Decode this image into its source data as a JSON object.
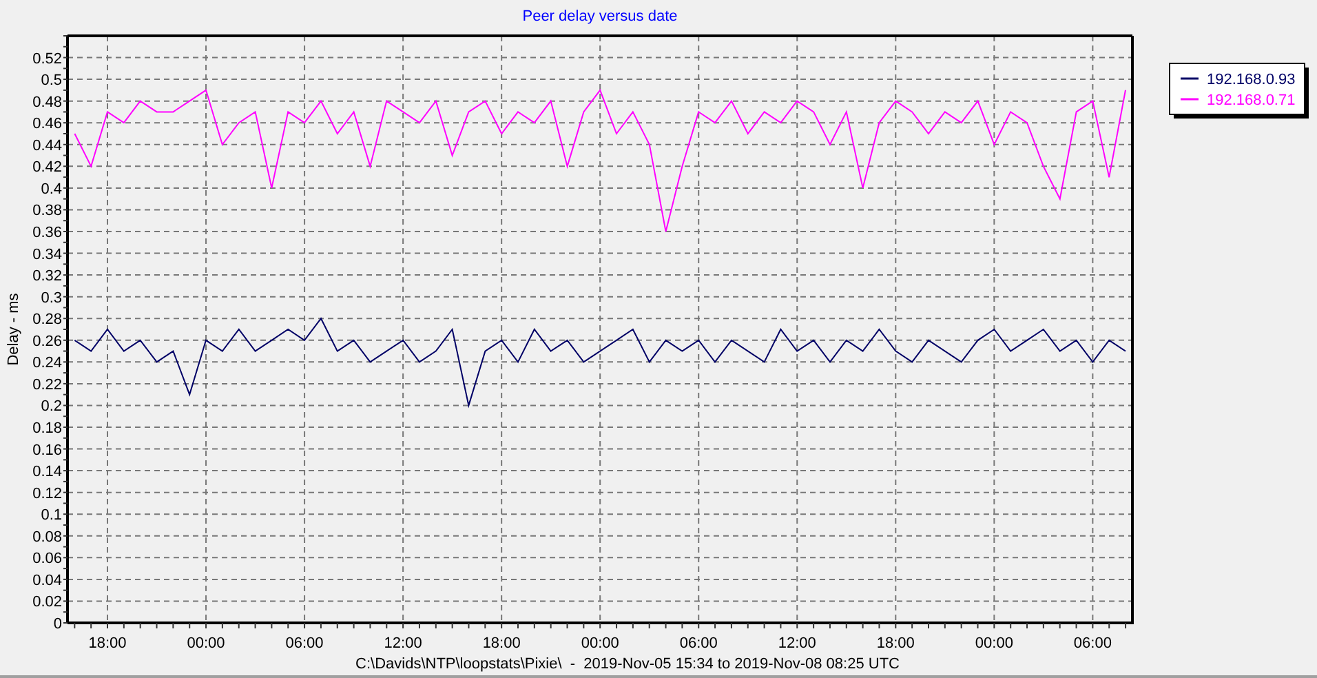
{
  "chart": {
    "chart_data": {
      "type": "line",
      "title": "Peer delay versus date",
      "xlabel": "C:\\Davids\\NTP\\loopstats\\Pixie\\  -  2019-Nov-05 15:34 to 2019-Nov-08 08:25 UTC",
      "ylabel": "Delay - ms",
      "x": [
        "2019-11-05T16:00",
        "2019-11-05T17:00",
        "2019-11-05T18:00",
        "2019-11-05T19:00",
        "2019-11-05T20:00",
        "2019-11-05T21:00",
        "2019-11-05T22:00",
        "2019-11-05T23:00",
        "2019-11-06T00:00",
        "2019-11-06T01:00",
        "2019-11-06T02:00",
        "2019-11-06T03:00",
        "2019-11-06T04:00",
        "2019-11-06T05:00",
        "2019-11-06T06:00",
        "2019-11-06T07:00",
        "2019-11-06T08:00",
        "2019-11-06T09:00",
        "2019-11-06T10:00",
        "2019-11-06T11:00",
        "2019-11-06T12:00",
        "2019-11-06T13:00",
        "2019-11-06T14:00",
        "2019-11-06T15:00",
        "2019-11-06T16:00",
        "2019-11-06T17:00",
        "2019-11-06T18:00",
        "2019-11-06T19:00",
        "2019-11-06T20:00",
        "2019-11-06T21:00",
        "2019-11-06T22:00",
        "2019-11-06T23:00",
        "2019-11-07T00:00",
        "2019-11-07T01:00",
        "2019-11-07T02:00",
        "2019-11-07T03:00",
        "2019-11-07T04:00",
        "2019-11-07T05:00",
        "2019-11-07T06:00",
        "2019-11-07T07:00",
        "2019-11-07T08:00",
        "2019-11-07T09:00",
        "2019-11-07T10:00",
        "2019-11-07T11:00",
        "2019-11-07T12:00",
        "2019-11-07T13:00",
        "2019-11-07T14:00",
        "2019-11-07T15:00",
        "2019-11-07T16:00",
        "2019-11-07T17:00",
        "2019-11-07T18:00",
        "2019-11-07T19:00",
        "2019-11-07T20:00",
        "2019-11-07T21:00",
        "2019-11-07T22:00",
        "2019-11-07T23:00",
        "2019-11-08T00:00",
        "2019-11-08T01:00",
        "2019-11-08T02:00",
        "2019-11-08T03:00",
        "2019-11-08T04:00",
        "2019-11-08T05:00",
        "2019-11-08T06:00",
        "2019-11-08T07:00",
        "2019-11-08T08:00"
      ],
      "series": [
        {
          "name": "192.168.0.93",
          "color": "#000066",
          "values": [
            0.26,
            0.25,
            0.27,
            0.25,
            0.26,
            0.24,
            0.25,
            0.21,
            0.26,
            0.25,
            0.27,
            0.25,
            0.26,
            0.27,
            0.26,
            0.28,
            0.25,
            0.26,
            0.24,
            0.25,
            0.26,
            0.24,
            0.25,
            0.27,
            0.2,
            0.25,
            0.26,
            0.24,
            0.27,
            0.25,
            0.26,
            0.24,
            0.25,
            0.26,
            0.27,
            0.24,
            0.26,
            0.25,
            0.26,
            0.24,
            0.26,
            0.25,
            0.24,
            0.27,
            0.25,
            0.26,
            0.24,
            0.26,
            0.25,
            0.27,
            0.25,
            0.24,
            0.26,
            0.25,
            0.24,
            0.26,
            0.27,
            0.25,
            0.26,
            0.27,
            0.25,
            0.26,
            0.24,
            0.26,
            0.25
          ]
        },
        {
          "name": "192.168.0.71",
          "color": "#ff00ff",
          "values": [
            0.45,
            0.42,
            0.47,
            0.46,
            0.48,
            0.47,
            0.47,
            0.48,
            0.49,
            0.44,
            0.46,
            0.47,
            0.4,
            0.47,
            0.46,
            0.48,
            0.45,
            0.47,
            0.42,
            0.48,
            0.47,
            0.46,
            0.48,
            0.43,
            0.47,
            0.48,
            0.45,
            0.47,
            0.46,
            0.48,
            0.42,
            0.47,
            0.49,
            0.45,
            0.47,
            0.44,
            0.36,
            0.42,
            0.47,
            0.46,
            0.48,
            0.45,
            0.47,
            0.46,
            0.48,
            0.47,
            0.44,
            0.47,
            0.4,
            0.46,
            0.48,
            0.47,
            0.45,
            0.47,
            0.46,
            0.48,
            0.44,
            0.47,
            0.46,
            0.42,
            0.39,
            0.47,
            0.48,
            0.41,
            0.49
          ]
        }
      ],
      "xlim": [
        "2019-11-05T15:34",
        "2019-11-08T08:25"
      ],
      "ylim": [
        0,
        0.54
      ],
      "xticks": [
        {
          "value": "2019-11-05T18:00",
          "label": "18:00"
        },
        {
          "value": "2019-11-06T00:00",
          "label": "00:00"
        },
        {
          "value": "2019-11-06T06:00",
          "label": "06:00"
        },
        {
          "value": "2019-11-06T12:00",
          "label": "12:00"
        },
        {
          "value": "2019-11-06T18:00",
          "label": "18:00"
        },
        {
          "value": "2019-11-07T00:00",
          "label": "00:00"
        },
        {
          "value": "2019-11-07T06:00",
          "label": "06:00"
        },
        {
          "value": "2019-11-07T12:00",
          "label": "12:00"
        },
        {
          "value": "2019-11-07T18:00",
          "label": "18:00"
        },
        {
          "value": "2019-11-08T00:00",
          "label": "00:00"
        },
        {
          "value": "2019-11-08T06:00",
          "label": "06:00"
        }
      ],
      "yticks": [
        0,
        0.02,
        0.04,
        0.06,
        0.08,
        0.1,
        0.12,
        0.14,
        0.16,
        0.18,
        0.2,
        0.22,
        0.24,
        0.26,
        0.28,
        0.3,
        0.32,
        0.34,
        0.36,
        0.38,
        0.4,
        0.42,
        0.44,
        0.46,
        0.48,
        0.5,
        0.52
      ],
      "grid": true,
      "legend": true
    }
  }
}
